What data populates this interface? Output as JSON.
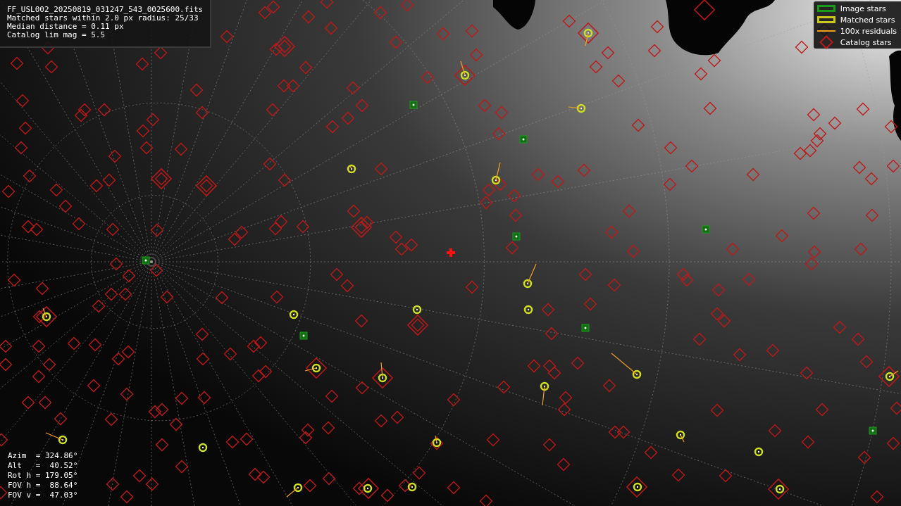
{
  "info_box": {
    "lines": [
      "FF_USL002_20250819_031247_543_0025600.fits",
      "Matched stars within 2.0 px radius: 25/33",
      "Median distance = 0.11 px",
      "Catalog lim mag = 5.5"
    ]
  },
  "legend": [
    {
      "kind": "box",
      "color": "#1a9a1a",
      "label": "Image stars"
    },
    {
      "kind": "box",
      "color": "#c8c81e",
      "label": "Matched stars"
    },
    {
      "kind": "line",
      "color": "#f0a020",
      "label": "100x residuals"
    },
    {
      "kind": "diamond",
      "color": "#c01818",
      "label": "Catalog stars"
    }
  ],
  "pointing": {
    "lines": [
      "Azim  = 324.86°",
      "Alt   =  40.52°",
      "Rot h = 179.05°",
      "FOV h =  88.64°",
      "FOV v =  47.03°"
    ]
  }
}
